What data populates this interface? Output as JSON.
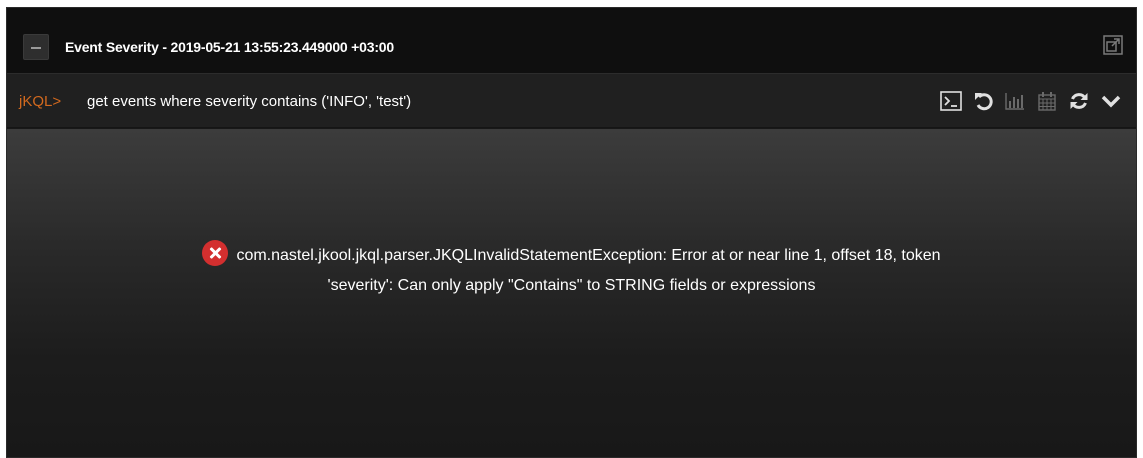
{
  "widget": {
    "title": "Event Severity - 2019-05-21 13:55:23.449000 +03:00"
  },
  "query": {
    "prompt": "jKQL>",
    "text": "get events where severity contains ('INFO', 'test')"
  },
  "toolbar": {
    "icons": [
      "terminal-icon",
      "undo-icon",
      "bar-chart-icon",
      "calendar-icon",
      "refresh-icon",
      "chevron-down-icon"
    ]
  },
  "error": {
    "line1": "com.nastel.jkool.jkql.parser.JKQLInvalidStatementException: Error at or near line 1, offset 18, token",
    "line2": "'severity': Can only apply \"Contains\" to STRING fields or expressions"
  },
  "colors": {
    "prompt": "#d2691e",
    "error_icon": "#d32f2f",
    "background": "#181818"
  }
}
